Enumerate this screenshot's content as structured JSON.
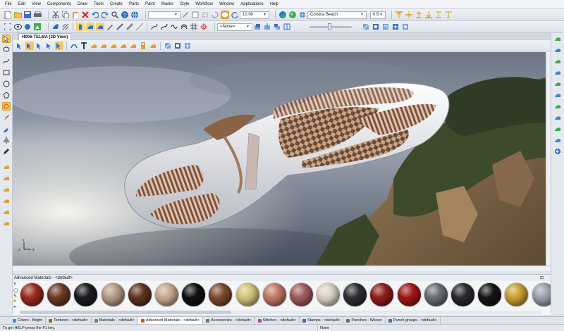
{
  "menu": [
    "File",
    "Edit",
    "View",
    "Components",
    "Draw",
    "Tools",
    "Create",
    "Parts",
    "Paint",
    "Masks",
    "Style",
    "Workflow",
    "Window",
    "Applications",
    "Help"
  ],
  "toolbar1": {
    "step_value": "10.00",
    "environment": "Corsica Beach",
    "opacity": "0.5"
  },
  "toolbar2": {
    "layer": "<None>"
  },
  "document_tab": "H006-TELMA (3D View)",
  "materials_panel": {
    "title": "Advanced Materials - <default>",
    "swatch_colors": [
      "#9a2a20",
      "#6b3a22",
      "#1c1c20",
      "#b49a82",
      "#5e3320",
      "#c8a890",
      "#101012",
      "#7a4a2c",
      "#d2c27a",
      "#c07a64",
      "#a05a5a",
      "#d8d2c2",
      "#2e2e34",
      "#8e1c1c",
      "#a01616",
      "#6a6e78",
      "#2a2a2e",
      "#151518",
      "#c9a030",
      "#9aa0aa"
    ]
  },
  "bottom_tabs": [
    {
      "label": "Colors - Bright",
      "color": "#4a8ad0"
    },
    {
      "label": "Textures - <default>",
      "color": "#8a6a4a"
    },
    {
      "label": "Materials - <default>",
      "color": "#7a7a7a"
    },
    {
      "label": "Advanced Materials - <default>",
      "color": "#c06020",
      "active": true
    },
    {
      "label": "Accessories - <default>",
      "color": "#5a8a5a"
    },
    {
      "label": "Stitches - <default>",
      "color": "#a04a8a"
    },
    {
      "label": "Stamps - <default>",
      "color": "#4a6aa0"
    },
    {
      "label": "Punches - Wieser",
      "color": "#6a6a6a"
    },
    {
      "label": "Punch groups - <default>",
      "color": "#3a7aa0"
    }
  ],
  "status": {
    "message": "To get HELP press the F1 key.",
    "selection": "None"
  },
  "colors": {
    "accent_orange": "#f0a020",
    "icon_blue": "#2f6fc8"
  }
}
